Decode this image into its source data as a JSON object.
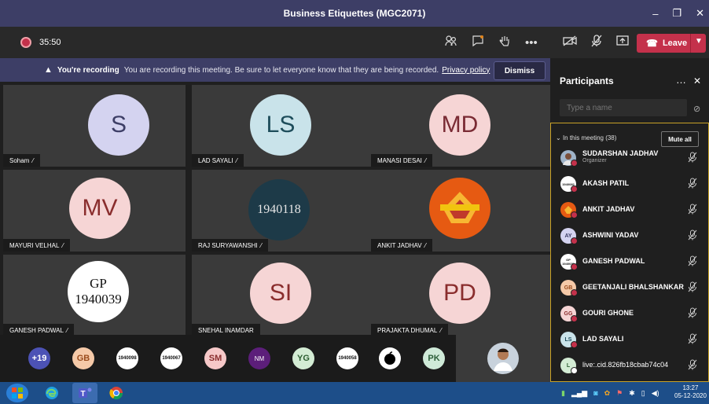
{
  "window": {
    "title": "Business Etiquettes (MGC2071)",
    "minimize": "–",
    "maximize": "❐",
    "close": "✕"
  },
  "toolbar": {
    "timer": "35:50",
    "leave_label": "Leave"
  },
  "banner": {
    "bold_text": "You're recording",
    "message": "You are recording this meeting. Be sure to let everyone know that they are being recorded.",
    "link": "Privacy policy",
    "dismiss_label": "Dismiss"
  },
  "tiles": [
    {
      "name": "Soham",
      "initials": "S",
      "bg": "#d4d3f0",
      "fg": "#3d3e66"
    },
    {
      "name": "LAD SAYALI",
      "initials": "LS",
      "bg": "#c9e3ea",
      "fg": "#1d4c5a"
    },
    {
      "name": "MANASI DESAI",
      "initials": "MD",
      "bg": "#f6d5d5",
      "fg": "#7a2b34"
    },
    {
      "name": "MAYURI VELHAL",
      "initials": "MV",
      "bg": "#f6d5d5",
      "fg": "#8a2d2d"
    },
    {
      "name": "RAJ SURYAWANSHI",
      "initials": "1940118",
      "bg": "#1d3a48",
      "fg": "#e6e6e6"
    },
    {
      "name": "ANKIT JADHAV",
      "initials": "",
      "bg": "#e65a12",
      "fg": "#ffffff"
    },
    {
      "name": "GANESH PADWAL",
      "initials": "GP 1940039",
      "bg": "#ffffff",
      "fg": "#111111"
    },
    {
      "name": "SNEHAL INAMDAR",
      "initials": "SI",
      "bg": "#f6d5d5",
      "fg": "#8a2d2d"
    },
    {
      "name": "PRAJAKTA DHUMAL",
      "initials": "PD",
      "bg": "#f6d5d5",
      "fg": "#8a2d2d"
    }
  ],
  "strip": [
    {
      "label": "+19",
      "bg": "#4c52b5",
      "fg": "#fff"
    },
    {
      "label": "GB",
      "bg": "#f5c9a8",
      "fg": "#9a4c1d"
    },
    {
      "label": "1940098",
      "bg": "#ffffff",
      "fg": "#111"
    },
    {
      "label": "1940067",
      "bg": "#ffffff",
      "fg": "#111"
    },
    {
      "label": "SM",
      "bg": "#f6c8c8",
      "fg": "#8a2d2d"
    },
    {
      "label": "NM",
      "bg": "#5c1e7a",
      "fg": "#fff"
    },
    {
      "label": "YG",
      "bg": "#d3ecd4",
      "fg": "#2d5f32"
    },
    {
      "label": "1940058",
      "bg": "#ffffff",
      "fg": "#111"
    },
    {
      "label": "",
      "bg": "#ffffff",
      "fg": "#000"
    },
    {
      "label": "PK",
      "bg": "#cfead8",
      "fg": "#2d5f3a"
    }
  ],
  "panel": {
    "title": "Participants",
    "search_placeholder": "Type a name",
    "group_label": "In this meeting (38)",
    "mute_all": "Mute all",
    "participants": [
      {
        "name": "SUDARSHAN JADHAV",
        "role": "Organizer",
        "initials": "",
        "bg": "#9fb3c8",
        "fg": "#fff"
      },
      {
        "name": "AKASH PATIL",
        "role": "",
        "initials": "1940082",
        "bg": "#ffffff",
        "fg": "#111"
      },
      {
        "name": "ANKIT JADHAV",
        "role": "",
        "initials": "",
        "bg": "#e65a12",
        "fg": "#fff"
      },
      {
        "name": "ASHWINI YADAV",
        "role": "",
        "initials": "AY",
        "bg": "#d4d3f0",
        "fg": "#3d3e66"
      },
      {
        "name": "GANESH PADWAL",
        "role": "",
        "initials": "GP 1940039",
        "bg": "#ffffff",
        "fg": "#111"
      },
      {
        "name": "GEETANJALI BHALSHANKAR",
        "role": "",
        "initials": "GB",
        "bg": "#f5c9a8",
        "fg": "#9a4c1d"
      },
      {
        "name": "GOURI GHONE",
        "role": "",
        "initials": "GG",
        "bg": "#f6d5d5",
        "fg": "#8a2d2d"
      },
      {
        "name": "LAD SAYALI",
        "role": "",
        "initials": "LS",
        "bg": "#c9e3ea",
        "fg": "#1d4c5a"
      },
      {
        "name": "live:.cid.826fb18cbab74c04",
        "role": "",
        "initials": "L",
        "bg": "#d3ecd4",
        "fg": "#2d5f32"
      }
    ]
  },
  "taskbar": {
    "time": "13:27",
    "date": "05-12-2020"
  }
}
